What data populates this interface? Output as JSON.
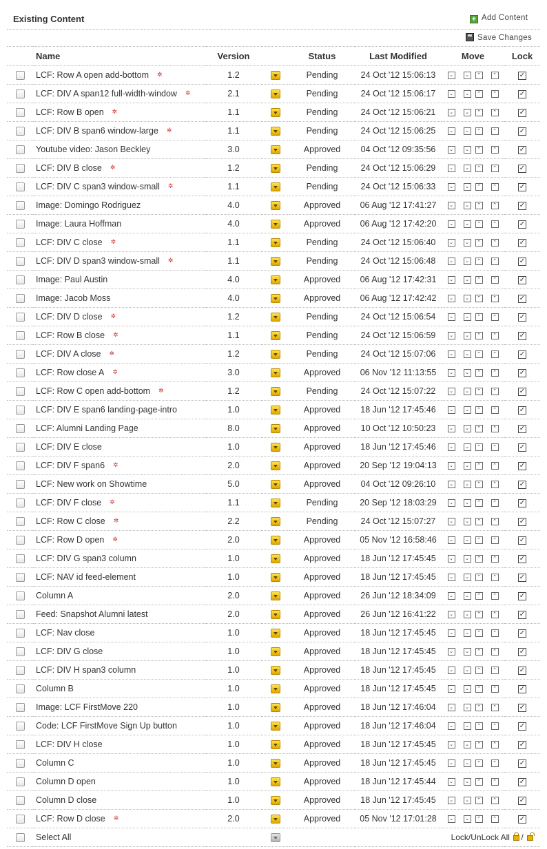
{
  "header": {
    "title": "Existing Content",
    "add_content": "Add Content",
    "save_changes": "Save Changes"
  },
  "columns": {
    "name": "Name",
    "version": "Version",
    "status": "Status",
    "last_modified": "Last Modified",
    "move": "Move",
    "lock": "Lock"
  },
  "rows": [
    {
      "name": "LCF: Row A open add-bottom",
      "version": "1.2",
      "status": "Pending",
      "modified": "24 Oct '12 15:06:13",
      "star": true
    },
    {
      "name": "LCF: DIV A span12 full-width-window",
      "version": "2.1",
      "status": "Pending",
      "modified": "24 Oct '12 15:06:17",
      "star": true
    },
    {
      "name": "LCF: Row B open",
      "version": "1.1",
      "status": "Pending",
      "modified": "24 Oct '12 15:06:21",
      "star": true
    },
    {
      "name": "LCF: DIV B span6 window-large",
      "version": "1.1",
      "status": "Pending",
      "modified": "24 Oct '12 15:06:25",
      "star": true
    },
    {
      "name": "Youtube video: Jason Beckley",
      "version": "3.0",
      "status": "Approved",
      "modified": "04 Oct '12 09:35:56",
      "star": false
    },
    {
      "name": "LCF: DIV B close",
      "version": "1.2",
      "status": "Pending",
      "modified": "24 Oct '12 15:06:29",
      "star": true
    },
    {
      "name": "LCF: DIV C span3 window-small",
      "version": "1.1",
      "status": "Pending",
      "modified": "24 Oct '12 15:06:33",
      "star": true
    },
    {
      "name": "Image: Domingo Rodriguez",
      "version": "4.0",
      "status": "Approved",
      "modified": "06 Aug '12 17:41:27",
      "star": false
    },
    {
      "name": "Image: Laura Hoffman",
      "version": "4.0",
      "status": "Approved",
      "modified": "06 Aug '12 17:42:20",
      "star": false
    },
    {
      "name": "LCF: DIV C close",
      "version": "1.1",
      "status": "Pending",
      "modified": "24 Oct '12 15:06:40",
      "star": true
    },
    {
      "name": "LCF: DIV D span3 window-small",
      "version": "1.1",
      "status": "Pending",
      "modified": "24 Oct '12 15:06:48",
      "star": true
    },
    {
      "name": "Image: Paul Austin",
      "version": "4.0",
      "status": "Approved",
      "modified": "06 Aug '12 17:42:31",
      "star": false
    },
    {
      "name": "Image: Jacob Moss",
      "version": "4.0",
      "status": "Approved",
      "modified": "06 Aug '12 17:42:42",
      "star": false
    },
    {
      "name": "LCF: DIV D close",
      "version": "1.2",
      "status": "Pending",
      "modified": "24 Oct '12 15:06:54",
      "star": true
    },
    {
      "name": "LCF: Row B close",
      "version": "1.1",
      "status": "Pending",
      "modified": "24 Oct '12 15:06:59",
      "star": true
    },
    {
      "name": "LCF: DIV A close",
      "version": "1.2",
      "status": "Pending",
      "modified": "24 Oct '12 15:07:06",
      "star": true
    },
    {
      "name": "LCF: Row close A",
      "version": "3.0",
      "status": "Approved",
      "modified": "06 Nov '12 11:13:55",
      "star": true
    },
    {
      "name": "LCF: Row C open add-bottom",
      "version": "1.2",
      "status": "Pending",
      "modified": "24 Oct '12 15:07:22",
      "star": true
    },
    {
      "name": "LCF: DIV E span6 landing-page-intro",
      "version": "1.0",
      "status": "Approved",
      "modified": "18 Jun '12 17:45:46",
      "star": false
    },
    {
      "name": "LCF: Alumni Landing Page",
      "version": "8.0",
      "status": "Approved",
      "modified": "10 Oct '12 10:50:23",
      "star": false
    },
    {
      "name": "LCF: DIV E close",
      "version": "1.0",
      "status": "Approved",
      "modified": "18 Jun '12 17:45:46",
      "star": false
    },
    {
      "name": "LCF: DIV F span6",
      "version": "2.0",
      "status": "Approved",
      "modified": "20 Sep '12 19:04:13",
      "star": true
    },
    {
      "name": "LCF: New work on Showtime",
      "version": "5.0",
      "status": "Approved",
      "modified": "04 Oct '12 09:26:10",
      "star": false
    },
    {
      "name": "LCF: DIV F close",
      "version": "1.1",
      "status": "Pending",
      "modified": "20 Sep '12 18:03:29",
      "star": true
    },
    {
      "name": "LCF: Row C close",
      "version": "2.2",
      "status": "Pending",
      "modified": "24 Oct '12 15:07:27",
      "star": true
    },
    {
      "name": "LCF: Row D open",
      "version": "2.0",
      "status": "Approved",
      "modified": "05 Nov '12 16:58:46",
      "star": true
    },
    {
      "name": "LCF: DIV G span3 column",
      "version": "1.0",
      "status": "Approved",
      "modified": "18 Jun '12 17:45:45",
      "star": false
    },
    {
      "name": "LCF: NAV id feed-element",
      "version": "1.0",
      "status": "Approved",
      "modified": "18 Jun '12 17:45:45",
      "star": false
    },
    {
      "name": "Column A",
      "version": "2.0",
      "status": "Approved",
      "modified": "26 Jun '12 18:34:09",
      "star": false
    },
    {
      "name": "Feed: Snapshot Alumni latest",
      "version": "2.0",
      "status": "Approved",
      "modified": "26 Jun '12 16:41:22",
      "star": false
    },
    {
      "name": "LCF: Nav close",
      "version": "1.0",
      "status": "Approved",
      "modified": "18 Jun '12 17:45:45",
      "star": false
    },
    {
      "name": "LCF: DIV G close",
      "version": "1.0",
      "status": "Approved",
      "modified": "18 Jun '12 17:45:45",
      "star": false
    },
    {
      "name": "LCF: DIV H span3 column",
      "version": "1.0",
      "status": "Approved",
      "modified": "18 Jun '12 17:45:45",
      "star": false
    },
    {
      "name": "Column B",
      "version": "1.0",
      "status": "Approved",
      "modified": "18 Jun '12 17:45:45",
      "star": false
    },
    {
      "name": "Image: LCF FirstMove 220",
      "version": "1.0",
      "status": "Approved",
      "modified": "18 Jun '12 17:46:04",
      "star": false
    },
    {
      "name": "Code: LCF FirstMove Sign Up button",
      "version": "1.0",
      "status": "Approved",
      "modified": "18 Jun '12 17:46:04",
      "star": false
    },
    {
      "name": "LCF: DIV H close",
      "version": "1.0",
      "status": "Approved",
      "modified": "18 Jun '12 17:45:45",
      "star": false
    },
    {
      "name": "Column C",
      "version": "1.0",
      "status": "Approved",
      "modified": "18 Jun '12 17:45:45",
      "star": false
    },
    {
      "name": "Column D open",
      "version": "1.0",
      "status": "Approved",
      "modified": "18 Jun '12 17:45:44",
      "star": false
    },
    {
      "name": "Column D close",
      "version": "1.0",
      "status": "Approved",
      "modified": "18 Jun '12 17:45:45",
      "star": false
    },
    {
      "name": "LCF: Row D close",
      "version": "2.0",
      "status": "Approved",
      "modified": "05 Nov '12 17:01:28",
      "star": true
    }
  ],
  "footer": {
    "select_all": "Select All",
    "lock_unlock_all": "Lock/UnLock All",
    "separator": "/"
  },
  "icons": {
    "row_star": "✲",
    "move_bottom": "⌄",
    "move_down": "⌄",
    "move_up": "⌃",
    "move_top": "⌃",
    "lock_check": "✓"
  }
}
